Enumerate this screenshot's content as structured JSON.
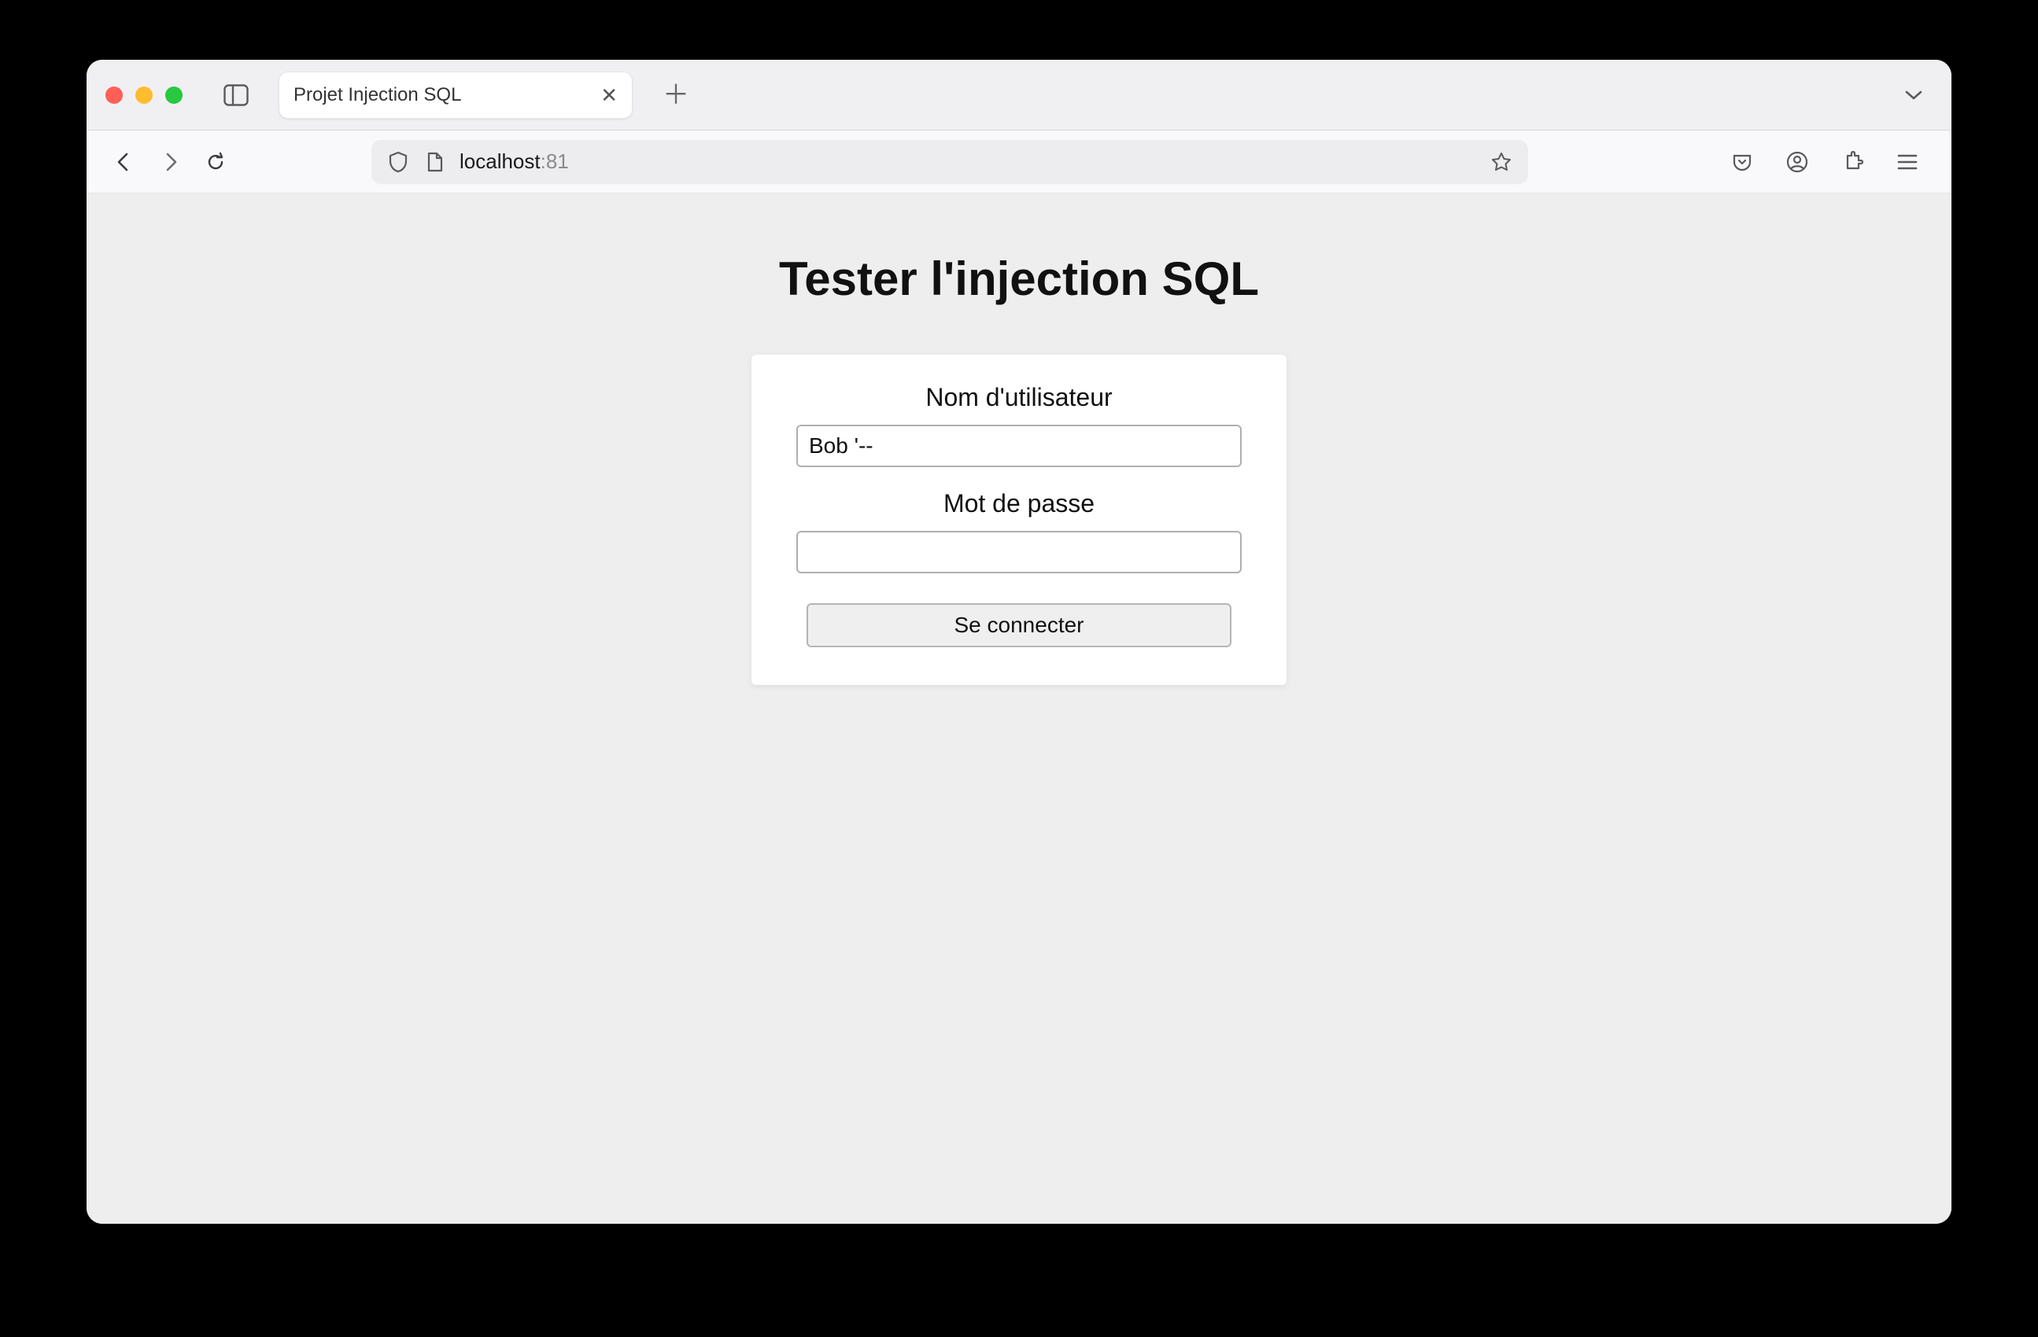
{
  "browser": {
    "tab_title": "Projet Injection SQL",
    "address_host": "localhost",
    "address_port": ":81"
  },
  "page": {
    "title": "Tester l'injection SQL",
    "username_label": "Nom d'utilisateur",
    "username_value": "Bob '--",
    "password_label": "Mot de passe",
    "password_value": "",
    "submit_label": "Se connecter"
  }
}
